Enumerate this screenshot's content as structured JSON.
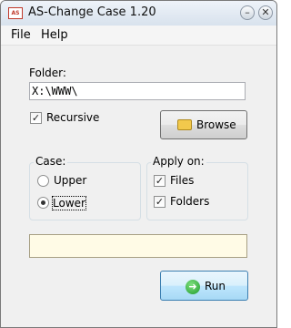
{
  "window": {
    "title": "AS-Change Case 1.20",
    "icon_label": "AS",
    "minimize": "–",
    "close": "✕"
  },
  "menu": [
    "File",
    "Help"
  ],
  "folder": {
    "label": "Folder:",
    "value": "X:\\WWW\\"
  },
  "recursive": {
    "label": "Recursive",
    "checked": true
  },
  "browse_label": "Browse",
  "case": {
    "legend": "Case:",
    "options": [
      "Upper",
      "Lower"
    ],
    "selected": "Lower"
  },
  "apply_on": {
    "legend": "Apply on:",
    "items": [
      {
        "label": "Files",
        "checked": true
      },
      {
        "label": "Folders",
        "checked": true
      }
    ]
  },
  "status_text": "",
  "run_label": "Run",
  "icons": {
    "app": "app-icon",
    "browse": "folder-icon",
    "run": "go-arrow-icon"
  }
}
